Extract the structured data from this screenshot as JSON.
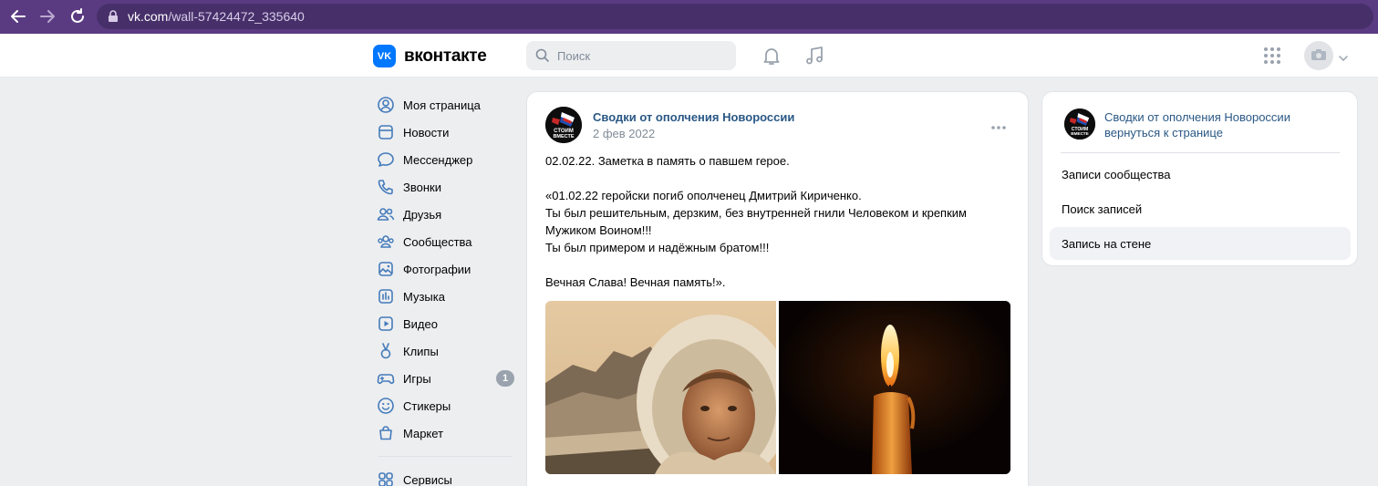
{
  "browser": {
    "url_host": "vk.com",
    "url_path": "/wall-57424472_335640"
  },
  "header": {
    "logo_badge": "VK",
    "logo_text": "вконтакте",
    "search_placeholder": "Поиск"
  },
  "nav": {
    "items": [
      {
        "label": "Моя страница",
        "icon": "user-icon"
      },
      {
        "label": "Новости",
        "icon": "news-icon"
      },
      {
        "label": "Мессенджер",
        "icon": "message-icon"
      },
      {
        "label": "Звонки",
        "icon": "phone-icon"
      },
      {
        "label": "Друзья",
        "icon": "friends-icon"
      },
      {
        "label": "Сообщества",
        "icon": "groups-icon"
      },
      {
        "label": "Фотографии",
        "icon": "photo-icon"
      },
      {
        "label": "Музыка",
        "icon": "music-icon"
      },
      {
        "label": "Видео",
        "icon": "video-icon"
      },
      {
        "label": "Клипы",
        "icon": "clips-icon"
      },
      {
        "label": "Игры",
        "icon": "games-icon",
        "badge": "1"
      },
      {
        "label": "Стикеры",
        "icon": "sticker-icon"
      },
      {
        "label": "Маркет",
        "icon": "market-icon"
      }
    ],
    "services_label": "Сервисы"
  },
  "post": {
    "author": "Сводки от ополчения Новороссии",
    "date": "2 фев 2022",
    "avatar_text_1": "СТОИМ",
    "avatar_text_2": "ВМЕСТЕ",
    "lines": {
      "l1": "02.02.22. Заметка в память о павшем герое.",
      "l2": "«01.02.22 геройски погиб ополченец Дмитрий Кириченко.",
      "l3": "Ты был решительным, дерзким, без внутренней гнили Человеком и крепким",
      "l4": "Мужиком Воином!!!",
      "l5": "Ты был примером и надёжным братом!!!",
      "l6": "Вечная Слава! Вечная память!»."
    }
  },
  "right_panel": {
    "community_name": "Сводки от ополчения Новороссии",
    "back_link": "вернуться к странице",
    "items": [
      "Записи сообщества",
      "Поиск записей",
      "Запись на стене"
    ]
  },
  "colors": {
    "browser_bar": "#5a3b82",
    "vk_blue": "#0077ff",
    "link": "#2a5885",
    "nav_icon": "#447bba"
  }
}
